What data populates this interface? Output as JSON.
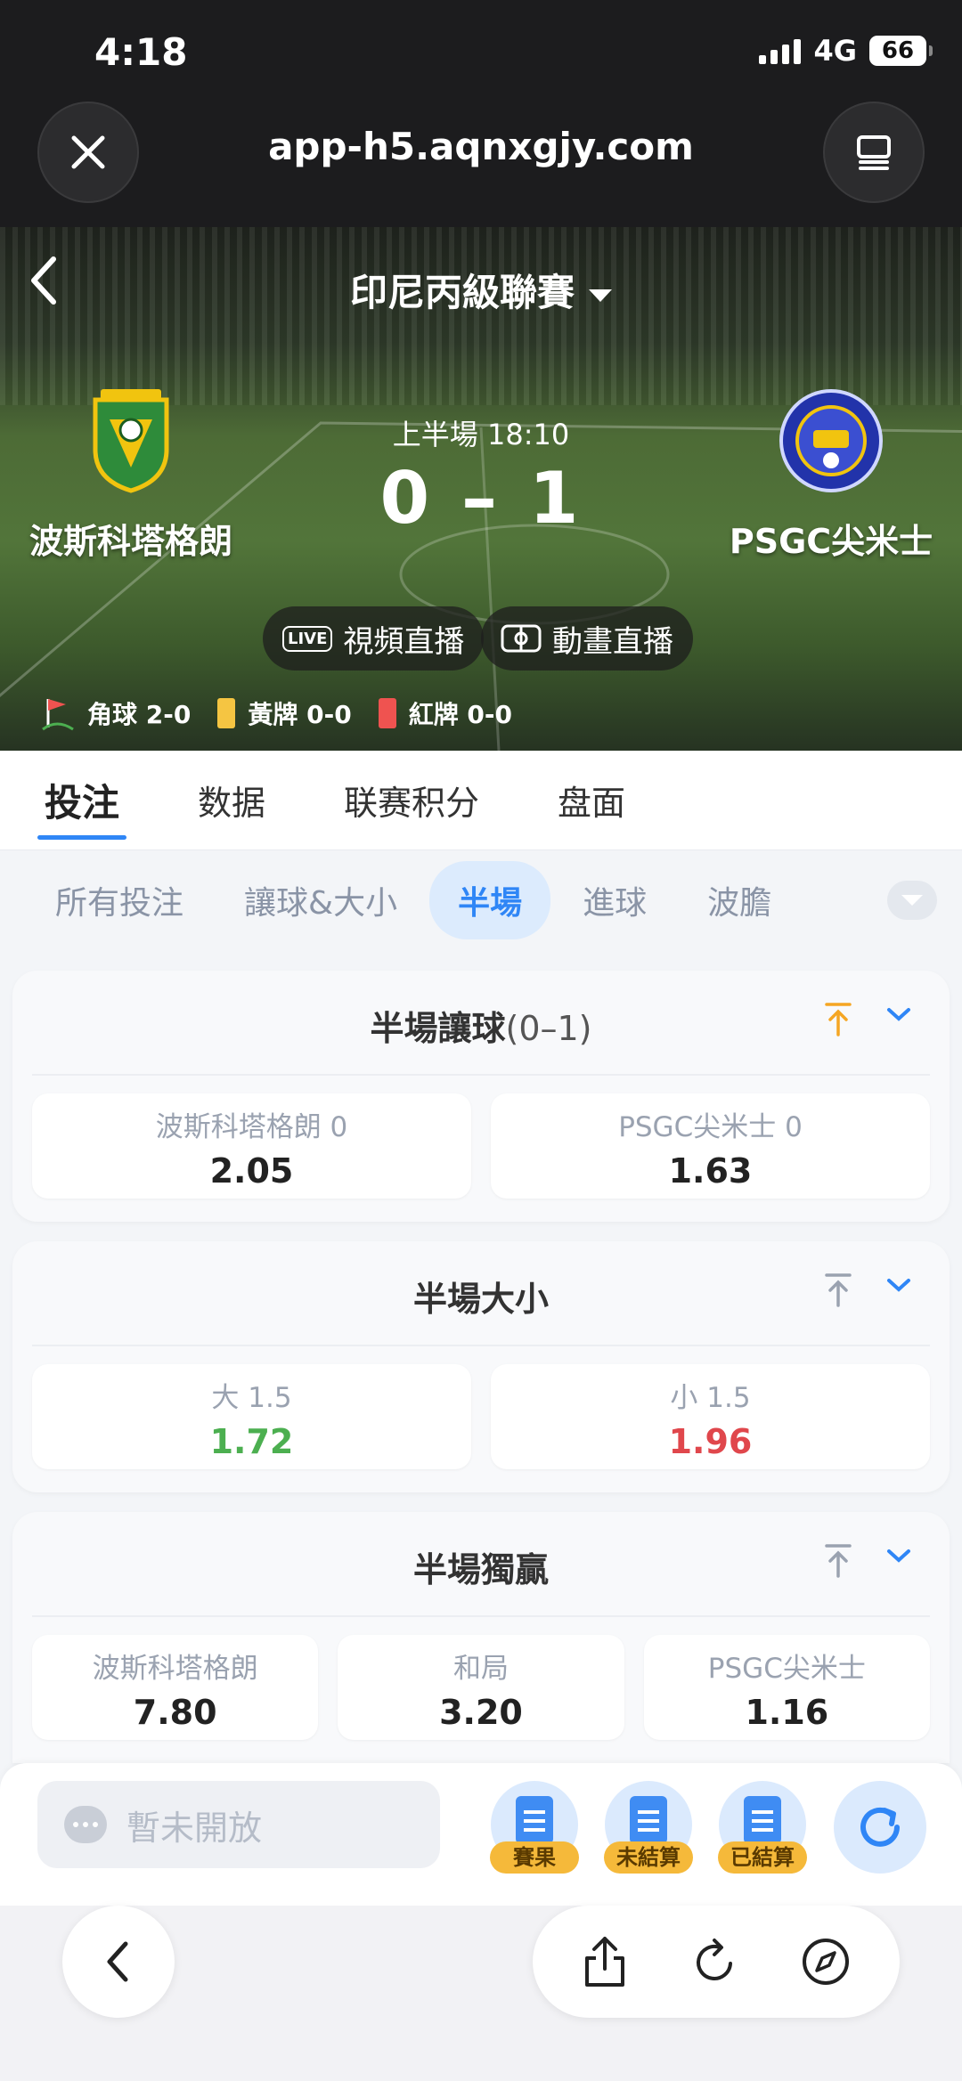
{
  "status_bar": {
    "time": "4:18",
    "network": "4G",
    "battery": "66"
  },
  "browser": {
    "url": "app-h5.aqnxgjy.com"
  },
  "match": {
    "league": "印尼丙級聯賽",
    "period": "上半場 18:10",
    "score": "0 – 1",
    "home_team": "波斯科塔格朗",
    "away_team": "PSGC尖米士",
    "video_live_label": "視頻直播",
    "animation_live_label": "動畫直播",
    "live_tag": "LIVE",
    "corners": "角球 2-0",
    "yellow_cards": "黃牌 0-0",
    "red_cards": "紅牌 0-0"
  },
  "main_tabs": [
    {
      "label": "投注",
      "active": true
    },
    {
      "label": "数据",
      "active": false
    },
    {
      "label": "联赛积分",
      "active": false
    },
    {
      "label": "盘面",
      "active": false
    }
  ],
  "sub_tabs": [
    {
      "label": "所有投注",
      "active": false
    },
    {
      "label": "讓球&大小",
      "active": false
    },
    {
      "label": "半場",
      "active": true
    },
    {
      "label": "進球",
      "active": false
    },
    {
      "label": "波膽",
      "active": false
    }
  ],
  "markets": [
    {
      "title": "半場讓球",
      "line": "(0–1)",
      "pin_color": "#f5a623",
      "odds": [
        {
          "label": "波斯科塔格朗 0",
          "value": "2.05",
          "trend": "none"
        },
        {
          "label": "PSGC尖米士 0",
          "value": "1.63",
          "trend": "none"
        }
      ]
    },
    {
      "title": "半場大小",
      "line": "",
      "pin_color": "#9aa2b0",
      "odds": [
        {
          "label": "大 1.5",
          "value": "1.72",
          "trend": "up"
        },
        {
          "label": "小 1.5",
          "value": "1.96",
          "trend": "down"
        }
      ]
    },
    {
      "title": "半場獨贏",
      "line": "",
      "pin_color": "#9aa2b0",
      "odds": [
        {
          "label": "波斯科塔格朗",
          "value": "7.80",
          "trend": "none"
        },
        {
          "label": "和局",
          "value": "3.20",
          "trend": "none"
        },
        {
          "label": "PSGC尖米士",
          "value": "1.16",
          "trend": "none"
        }
      ]
    }
  ],
  "bottom_bar": {
    "chat_placeholder": "暫未開放",
    "results_label": "賽果",
    "unsettled_label": "未結算",
    "settled_label": "已結算"
  },
  "colors": {
    "accent": "#2f86f6",
    "odds_up": "#4caf50",
    "odds_down": "#e0474c",
    "badge": "#f5b93a"
  }
}
